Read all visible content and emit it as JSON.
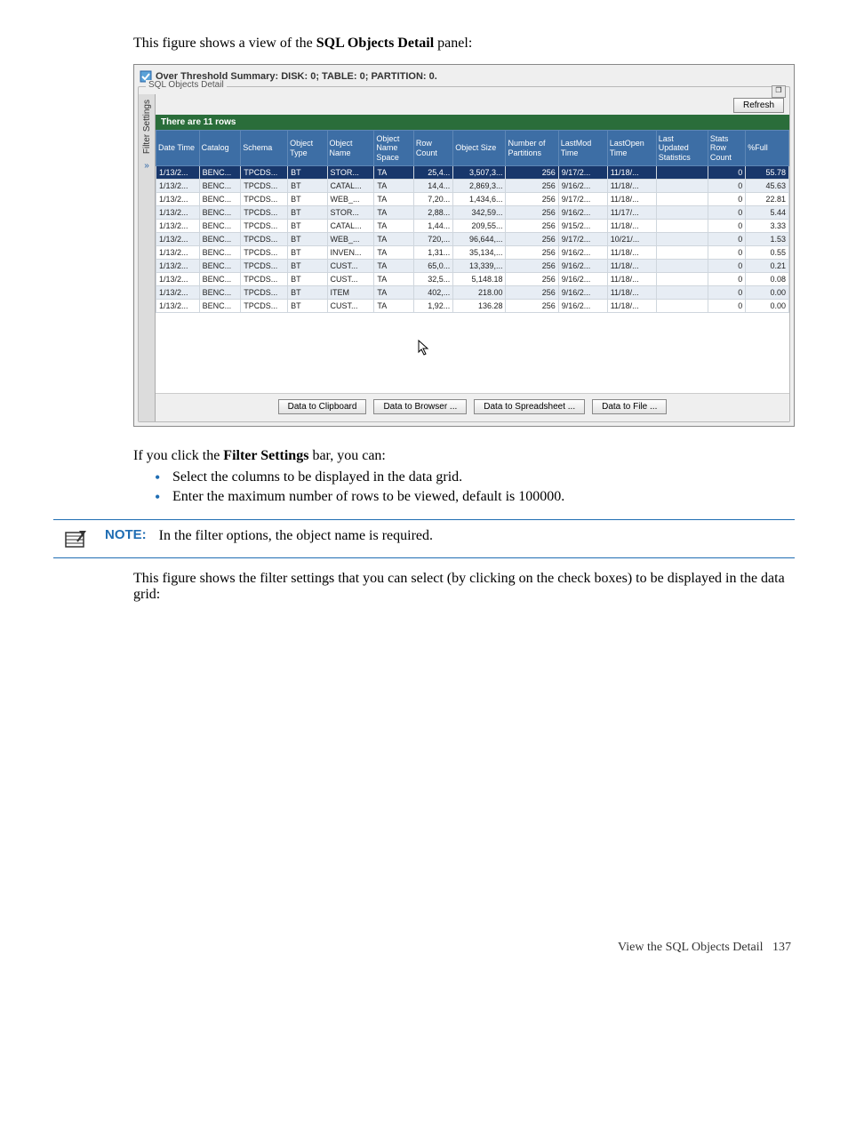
{
  "intro": {
    "pre": "This figure shows a view of the ",
    "bold": "SQL Objects Detail",
    "post": " panel:"
  },
  "panel": {
    "title": "Over Threshold Summary: DISK: 0; TABLE: 0; PARTITION: 0.",
    "group_label": "SQL Objects Detail",
    "restore_glyph": "❐",
    "vtab_label": "Filter Settings",
    "vtab_arrows": "»",
    "refresh_label": "Refresh",
    "status_text": "There are 11 rows",
    "headers": {
      "date_time": "Date Time",
      "catalog": "Catalog",
      "schema": "Schema",
      "obj_type": "Object Type",
      "obj_name": "Object Name",
      "obj_ns": "Object Name Space",
      "row_count": "Row Count",
      "obj_size": "Object Size",
      "num_parts": "Number of Partitions",
      "last_mod": "LastMod Time",
      "last_open": "LastOpen Time",
      "last_upd": "Last Updated Statistics",
      "stats_row": "Stats Row Count",
      "pct_full": "%Full"
    },
    "rows": [
      {
        "date": "1/13/2...",
        "cat": "BENC...",
        "sch": "TPCDS...",
        "otype": "BT",
        "oname": "STOR...",
        "ons": "TA",
        "rc": "25,4...",
        "os": "3,507,3...",
        "np": "256",
        "lm": "9/17/2...",
        "lo": "11/18/...",
        "lu": "",
        "src": "0",
        "pf": "55.78",
        "cls": "sel"
      },
      {
        "date": "1/13/2...",
        "cat": "BENC...",
        "sch": "TPCDS...",
        "otype": "BT",
        "oname": "CATAL...",
        "ons": "TA",
        "rc": "14,4...",
        "os": "2,869,3...",
        "np": "256",
        "lm": "9/16/2...",
        "lo": "11/18/...",
        "lu": "",
        "src": "0",
        "pf": "45.63",
        "cls": "even"
      },
      {
        "date": "1/13/2...",
        "cat": "BENC...",
        "sch": "TPCDS...",
        "otype": "BT",
        "oname": "WEB_...",
        "ons": "TA",
        "rc": "7,20...",
        "os": "1,434,6...",
        "np": "256",
        "lm": "9/17/2...",
        "lo": "11/18/...",
        "lu": "",
        "src": "0",
        "pf": "22.81",
        "cls": "odd"
      },
      {
        "date": "1/13/2...",
        "cat": "BENC...",
        "sch": "TPCDS...",
        "otype": "BT",
        "oname": "STOR...",
        "ons": "TA",
        "rc": "2,88...",
        "os": "342,59...",
        "np": "256",
        "lm": "9/16/2...",
        "lo": "11/17/...",
        "lu": "",
        "src": "0",
        "pf": "5.44",
        "cls": "even"
      },
      {
        "date": "1/13/2...",
        "cat": "BENC...",
        "sch": "TPCDS...",
        "otype": "BT",
        "oname": "CATAL...",
        "ons": "TA",
        "rc": "1,44...",
        "os": "209,55...",
        "np": "256",
        "lm": "9/15/2...",
        "lo": "11/18/...",
        "lu": "",
        "src": "0",
        "pf": "3.33",
        "cls": "odd"
      },
      {
        "date": "1/13/2...",
        "cat": "BENC...",
        "sch": "TPCDS...",
        "otype": "BT",
        "oname": "WEB_...",
        "ons": "TA",
        "rc": "720,...",
        "os": "96,644,...",
        "np": "256",
        "lm": "9/17/2...",
        "lo": "10/21/...",
        "lu": "",
        "src": "0",
        "pf": "1.53",
        "cls": "even"
      },
      {
        "date": "1/13/2...",
        "cat": "BENC...",
        "sch": "TPCDS...",
        "otype": "BT",
        "oname": "INVEN...",
        "ons": "TA",
        "rc": "1,31...",
        "os": "35,134,...",
        "np": "256",
        "lm": "9/16/2...",
        "lo": "11/18/...",
        "lu": "",
        "src": "0",
        "pf": "0.55",
        "cls": "odd"
      },
      {
        "date": "1/13/2...",
        "cat": "BENC...",
        "sch": "TPCDS...",
        "otype": "BT",
        "oname": "CUST...",
        "ons": "TA",
        "rc": "65,0...",
        "os": "13,339,...",
        "np": "256",
        "lm": "9/16/2...",
        "lo": "11/18/...",
        "lu": "",
        "src": "0",
        "pf": "0.21",
        "cls": "even"
      },
      {
        "date": "1/13/2...",
        "cat": "BENC...",
        "sch": "TPCDS...",
        "otype": "BT",
        "oname": "CUST...",
        "ons": "TA",
        "rc": "32,5...",
        "os": "5,148.18",
        "np": "256",
        "lm": "9/16/2...",
        "lo": "11/18/...",
        "lu": "",
        "src": "0",
        "pf": "0.08",
        "cls": "odd"
      },
      {
        "date": "1/13/2...",
        "cat": "BENC...",
        "sch": "TPCDS...",
        "otype": "BT",
        "oname": "ITEM",
        "ons": "TA",
        "rc": "402,...",
        "os": "218.00",
        "np": "256",
        "lm": "9/16/2...",
        "lo": "11/18/...",
        "lu": "",
        "src": "0",
        "pf": "0.00",
        "cls": "even"
      },
      {
        "date": "1/13/2...",
        "cat": "BENC...",
        "sch": "TPCDS...",
        "otype": "BT",
        "oname": "CUST...",
        "ons": "TA",
        "rc": "1,92...",
        "os": "136.28",
        "np": "256",
        "lm": "9/16/2...",
        "lo": "11/18/...",
        "lu": "",
        "src": "0",
        "pf": "0.00",
        "cls": "odd"
      }
    ],
    "buttons": {
      "clipboard": "Data to Clipboard",
      "browser": "Data to Browser ...",
      "spreadsheet": "Data to Spreadsheet ...",
      "file": "Data to File ..."
    }
  },
  "after_panel": {
    "line1_pre": "If you click the ",
    "line1_bold": "Filter Settings",
    "line1_post": " bar, you can:",
    "bullets": [
      "Select the columns to be displayed in the data grid.",
      "Enter the maximum number of rows to be viewed, default is 100000."
    ]
  },
  "note": {
    "label": "NOTE:",
    "text": "In the filter options, the object name is required."
  },
  "after_note": "This figure shows the filter settings that you can select (by clicking on the check boxes) to be displayed in the data grid:",
  "footer": {
    "text": "View the SQL Objects Detail",
    "page": "137"
  }
}
